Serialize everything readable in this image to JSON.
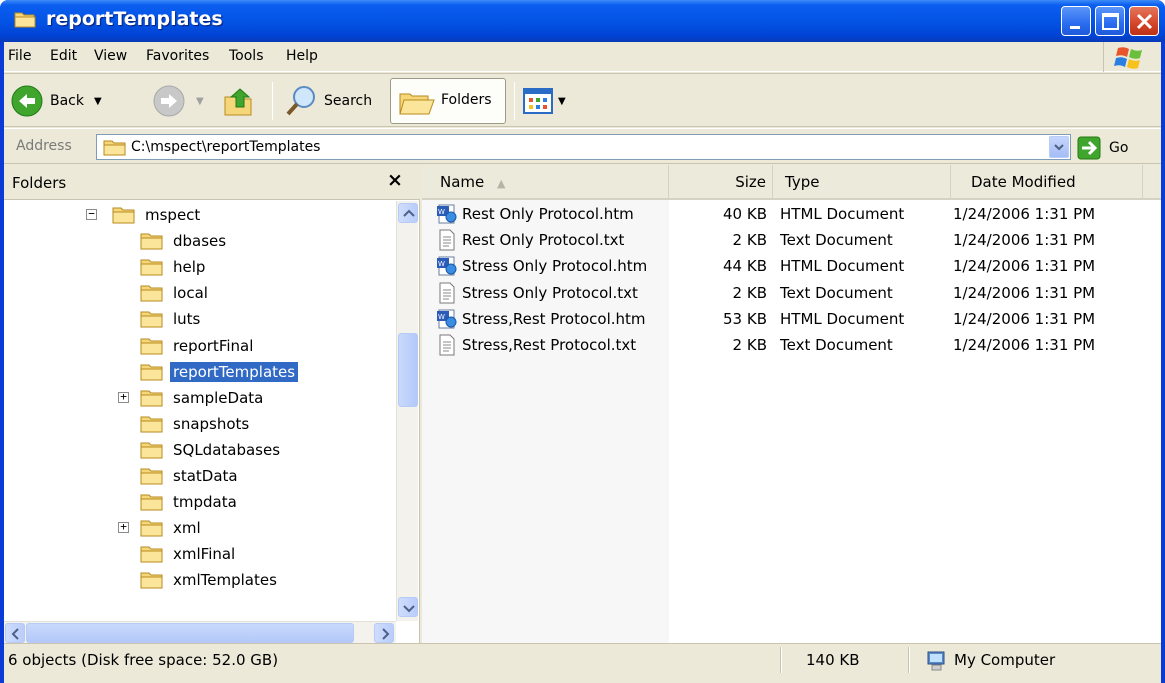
{
  "window": {
    "title": "reportTemplates"
  },
  "menu": [
    "File",
    "Edit",
    "View",
    "Favorites",
    "Tools",
    "Help"
  ],
  "toolbar": {
    "back_label": "Back",
    "search_label": "Search",
    "folders_label": "Folders"
  },
  "address": {
    "label": "Address",
    "value": "C:\\mspect\\reportTemplates",
    "go_label": "Go"
  },
  "folders_pane": {
    "title": "Folders",
    "items": [
      {
        "label": "mspect",
        "expander": "−"
      },
      {
        "label": "dbases"
      },
      {
        "label": "help"
      },
      {
        "label": "local"
      },
      {
        "label": "luts"
      },
      {
        "label": "reportFinal"
      },
      {
        "label": "reportTemplates",
        "selected": true
      },
      {
        "label": "sampleData",
        "expander": "+"
      },
      {
        "label": "snapshots"
      },
      {
        "label": "SQLdatabases"
      },
      {
        "label": "statData"
      },
      {
        "label": "tmpdata"
      },
      {
        "label": "xml",
        "expander": "+"
      },
      {
        "label": "xmlFinal"
      },
      {
        "label": "xmlTemplates"
      }
    ]
  },
  "columns": {
    "name": "Name",
    "size": "Size",
    "type": "Type",
    "date": "Date Modified"
  },
  "files": [
    {
      "icon": "html-document-icon",
      "name": "Rest Only Protocol.htm",
      "size": "40 KB",
      "type": "HTML Document",
      "date": "1/24/2006 1:31 PM"
    },
    {
      "icon": "text-document-icon",
      "name": "Rest Only Protocol.txt",
      "size": "2 KB",
      "type": "Text Document",
      "date": "1/24/2006 1:31 PM"
    },
    {
      "icon": "html-document-icon",
      "name": "Stress Only Protocol.htm",
      "size": "44 KB",
      "type": "HTML Document",
      "date": "1/24/2006 1:31 PM"
    },
    {
      "icon": "text-document-icon",
      "name": "Stress Only Protocol.txt",
      "size": "2 KB",
      "type": "Text Document",
      "date": "1/24/2006 1:31 PM"
    },
    {
      "icon": "html-document-icon",
      "name": "Stress,Rest Protocol.htm",
      "size": "53 KB",
      "type": "HTML Document",
      "date": "1/24/2006 1:31 PM"
    },
    {
      "icon": "text-document-icon",
      "name": "Stress,Rest Protocol.txt",
      "size": "2 KB",
      "type": "Text Document",
      "date": "1/24/2006 1:31 PM"
    }
  ],
  "status": {
    "objects": "6 objects (Disk free space: 52.0 GB)",
    "total_size": "140 KB",
    "location": "My Computer"
  },
  "colors": {
    "titlebar": "#0454e6",
    "selection": "#316ac5",
    "chrome": "#ece9d8",
    "close_button": "#d4452a"
  }
}
